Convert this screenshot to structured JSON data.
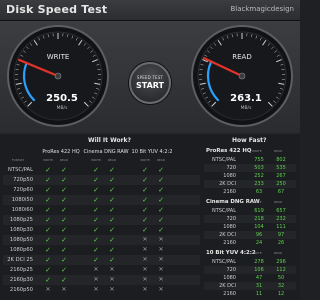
{
  "app": {
    "title": "Disk Speed Test",
    "brand": "Blackmagicdesign"
  },
  "write": {
    "label": "WRITE",
    "value": "250.5",
    "unit": "MB/s",
    "fraction": 0.25
  },
  "read": {
    "label": "READ",
    "value": "263.1",
    "unit": "MB/s",
    "fraction": 0.26
  },
  "start": {
    "top": "SPEED TEST",
    "label": "START"
  },
  "colors": {
    "check": "#5fd34d",
    "needle": "#e0332a",
    "gauge_arc": "#2aa1ff"
  },
  "will_it_work": {
    "title": "Will It Work?",
    "format_header": "FORMAT",
    "sub_headers": [
      "WRITE",
      "READ"
    ],
    "groups": [
      "ProRes 422 HQ",
      "Cinema DNG RAW",
      "10 Bit YUV 4:2:2"
    ],
    "rows": [
      {
        "format": "NTSC/PAL",
        "marks": [
          "y",
          "y",
          "y",
          "y",
          "y",
          "y"
        ]
      },
      {
        "format": "720p50",
        "marks": [
          "y",
          "y",
          "y",
          "y",
          "y",
          "y"
        ]
      },
      {
        "format": "720p60",
        "marks": [
          "y",
          "y",
          "y",
          "y",
          "y",
          "y"
        ]
      },
      {
        "format": "1080i50",
        "marks": [
          "y",
          "y",
          "y",
          "y",
          "y",
          "y"
        ]
      },
      {
        "format": "1080i60",
        "marks": [
          "y",
          "y",
          "y",
          "y",
          "y",
          "y"
        ]
      },
      {
        "format": "1080p25",
        "marks": [
          "y",
          "y",
          "y",
          "y",
          "y",
          "y"
        ]
      },
      {
        "format": "1080p30",
        "marks": [
          "y",
          "y",
          "y",
          "y",
          "y",
          "y"
        ]
      },
      {
        "format": "1080p50",
        "marks": [
          "y",
          "y",
          "y",
          "y",
          "x",
          "x"
        ]
      },
      {
        "format": "1080p60",
        "marks": [
          "y",
          "y",
          "y",
          "y",
          "x",
          "x"
        ]
      },
      {
        "format": "2K DCI 25",
        "marks": [
          "y",
          "y",
          "y",
          "y",
          "x",
          "x"
        ]
      },
      {
        "format": "2160p25",
        "marks": [
          "y",
          "y",
          "x",
          "x",
          "x",
          "x"
        ]
      },
      {
        "format": "2160p30",
        "marks": [
          "y",
          "y",
          "x",
          "x",
          "x",
          "x"
        ]
      },
      {
        "format": "2160p50",
        "marks": [
          "x",
          "x",
          "x",
          "x",
          "x",
          "x"
        ]
      }
    ]
  },
  "how_fast": {
    "title": "How Fast?",
    "sub_headers": [
      "WRITE",
      "READ"
    ],
    "groups": [
      {
        "name": "ProRes 422 HQ",
        "rows": [
          {
            "label": "NTSC/PAL",
            "write": "755",
            "read": "802"
          },
          {
            "label": "720",
            "write": "503",
            "read": "535"
          },
          {
            "label": "1080",
            "write": "252",
            "read": "267"
          },
          {
            "label": "2K DCI",
            "write": "233",
            "read": "250"
          },
          {
            "label": "2160",
            "write": "63",
            "read": "67"
          }
        ]
      },
      {
        "name": "Cinema DNG RAW",
        "rows": [
          {
            "label": "NTSC/PAL",
            "write": "619",
            "read": "657"
          },
          {
            "label": "720",
            "write": "218",
            "read": "232"
          },
          {
            "label": "1080",
            "write": "104",
            "read": "111"
          },
          {
            "label": "2K DCI",
            "write": "96",
            "read": "97"
          },
          {
            "label": "2160",
            "write": "24",
            "read": "26"
          }
        ]
      },
      {
        "name": "10 Bit YUV 4:2:2",
        "rows": [
          {
            "label": "NTSC/PAL",
            "write": "278",
            "read": "296"
          },
          {
            "label": "720",
            "write": "106",
            "read": "112"
          },
          {
            "label": "1080",
            "write": "47",
            "read": "50"
          },
          {
            "label": "2K DCI",
            "write": "31",
            "read": "32"
          },
          {
            "label": "2160",
            "write": "11",
            "read": "12"
          }
        ]
      }
    ]
  }
}
